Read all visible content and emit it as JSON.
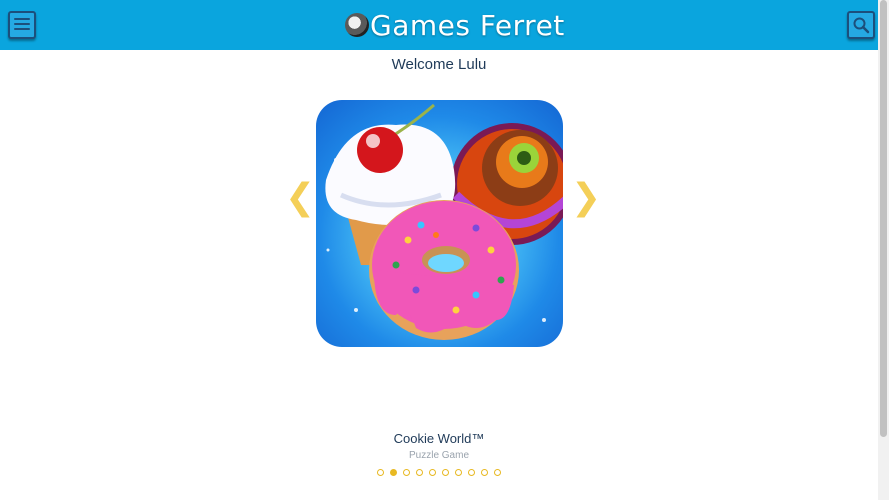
{
  "header": {
    "brand": "Games Ferret",
    "menu_icon": "menu-icon",
    "search_icon": "search-icon",
    "background_color": "#0aa5de"
  },
  "welcome": "Welcome Lulu",
  "carousel": {
    "prev_icon": "chevron-left-icon",
    "next_icon": "chevron-right-icon",
    "game": {
      "title": "Cookie World™",
      "genre": "Puzzle Game"
    },
    "page_count": 10,
    "active_page": 2,
    "accent_color": "#e8b923"
  }
}
